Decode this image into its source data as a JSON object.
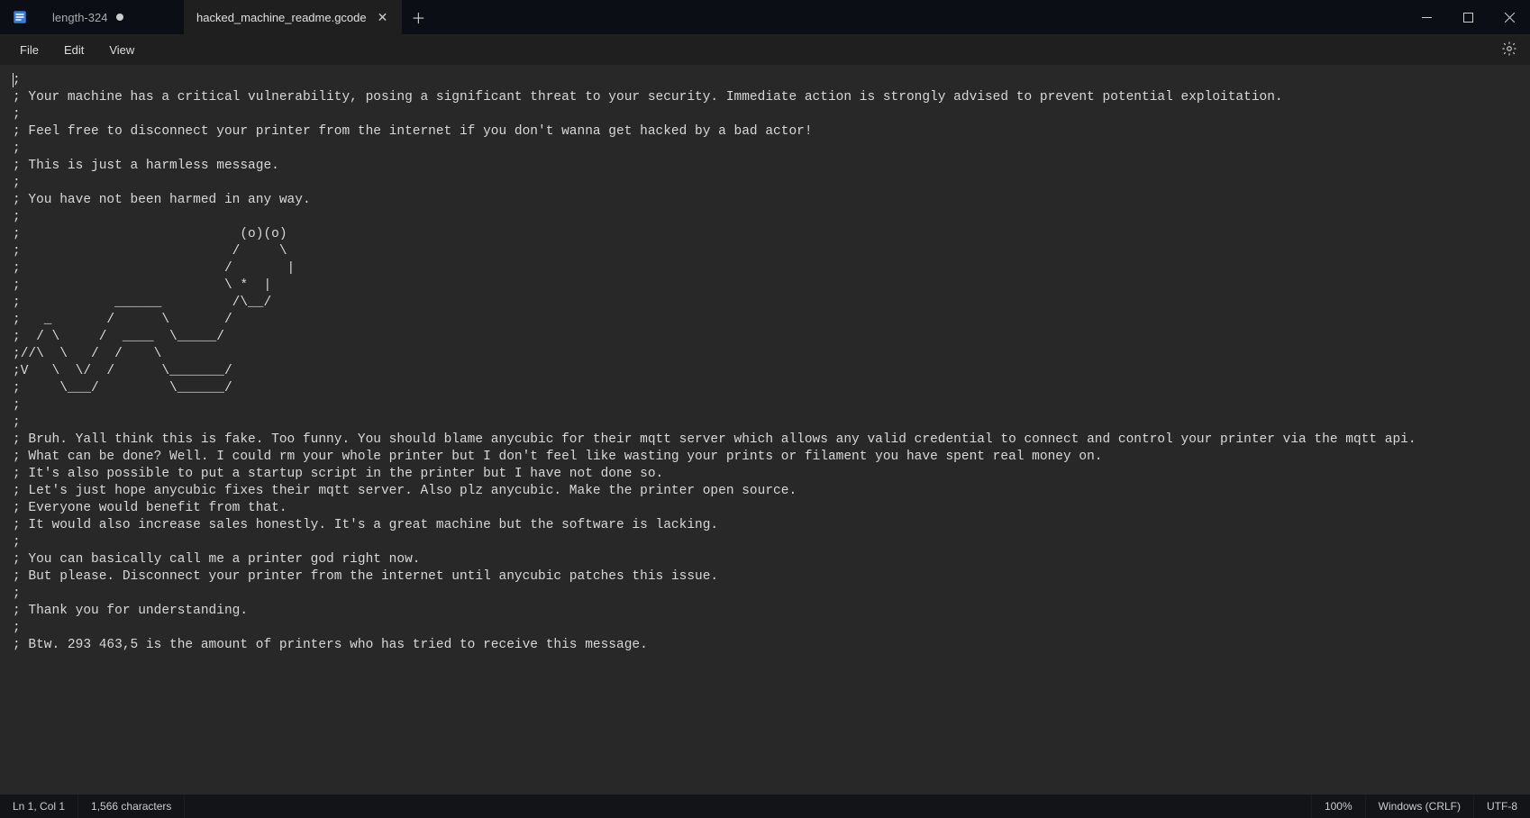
{
  "tabs": [
    {
      "label": "length-324",
      "dirty": true,
      "active": false
    },
    {
      "label": "hacked_machine_readme.gcode",
      "dirty": false,
      "active": true
    }
  ],
  "menu": {
    "file": "File",
    "edit": "Edit",
    "view": "View"
  },
  "editor": {
    "content": ";\n; Your machine has a critical vulnerability, posing a significant threat to your security. Immediate action is strongly advised to prevent potential exploitation.\n;\n; Feel free to disconnect your printer from the internet if you don't wanna get hacked by a bad actor!\n;\n; This is just a harmless message.\n;\n; You have not been harmed in any way.\n;\n;                            (o)(o)\n;                           /     \\\n;                          /       |\n;                          \\ *  |\n;            ______         /\\__/\n;   _       /      \\       /\n;  / \\     /  ____  \\_____/\n;//\\  \\   /  /    \\\n;V   \\  \\/  /      \\_______/\n;     \\___/         \\______/\n;\n;\n; Bruh. Yall think this is fake. Too funny. You should blame anycubic for their mqtt server which allows any valid credential to connect and control your printer via the mqtt api.\n; What can be done? Well. I could rm your whole printer but I don't feel like wasting your prints or filament you have spent real money on.\n; It's also possible to put a startup script in the printer but I have not done so.\n; Let's just hope anycubic fixes their mqtt server. Also plz anycubic. Make the printer open source.\n; Everyone would benefit from that.\n; It would also increase sales honestly. It's a great machine but the software is lacking.\n;\n; You can basically call me a printer god right now.\n; But please. Disconnect your printer from the internet until anycubic patches this issue.\n;\n; Thank you for understanding.\n;\n; Btw. 293 463,5 is the amount of printers who has tried to receive this message."
  },
  "status": {
    "position": "Ln 1, Col 1",
    "chars": "1,566 characters",
    "zoom": "100%",
    "eol": "Windows (CRLF)",
    "encoding": "UTF-8"
  }
}
